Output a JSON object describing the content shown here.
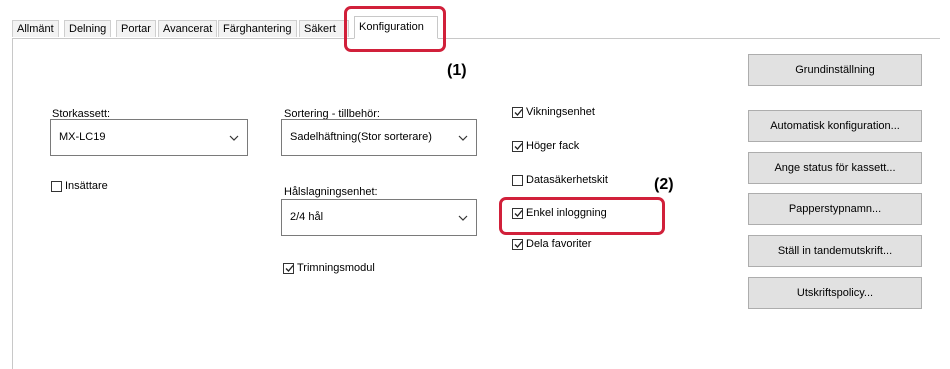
{
  "tabs": [
    {
      "label": "Allmänt",
      "active": false
    },
    {
      "label": "Delning",
      "active": false
    },
    {
      "label": "Portar",
      "active": false
    },
    {
      "label": "Avancerat",
      "active": false
    },
    {
      "label": "Färghantering",
      "active": false
    },
    {
      "label": "Säkert",
      "active": false
    },
    {
      "label": "Konfiguration",
      "active": true
    }
  ],
  "left": {
    "storkassett_label": "Storkassett:",
    "storkassett_value": "MX-LC19",
    "insattare": {
      "label": "Insättare",
      "checked": false
    }
  },
  "middle": {
    "sortering_label": "Sortering - tillbehör:",
    "sortering_value": "Sadelhäftning(Stor sorterare)",
    "halslagning_label": "Hålslagningsenhet:",
    "halslagning_value": "2/4 hål",
    "trimning": {
      "label": "Trimningsmodul",
      "checked": true
    }
  },
  "options": [
    {
      "label": "Vikningsenhet",
      "checked": true
    },
    {
      "label": "Höger fack",
      "checked": true
    },
    {
      "label": "Datasäkerhetskit",
      "checked": false
    },
    {
      "label": "Enkel inloggning",
      "checked": true
    },
    {
      "label": "Dela favoriter",
      "checked": true
    }
  ],
  "buttons": {
    "grundinstallning": "Grundinställning",
    "automatisk": "Automatisk konfiguration...",
    "ange_status": "Ange status för kassett...",
    "papperstypnamn": "Papperstypnamn...",
    "tandem": "Ställ in tandemutskrift...",
    "utskriftspolicy": "Utskriftspolicy..."
  },
  "annotations": {
    "marker1": "(1)",
    "marker2": "(2)",
    "callout_color": "#d1203a"
  }
}
